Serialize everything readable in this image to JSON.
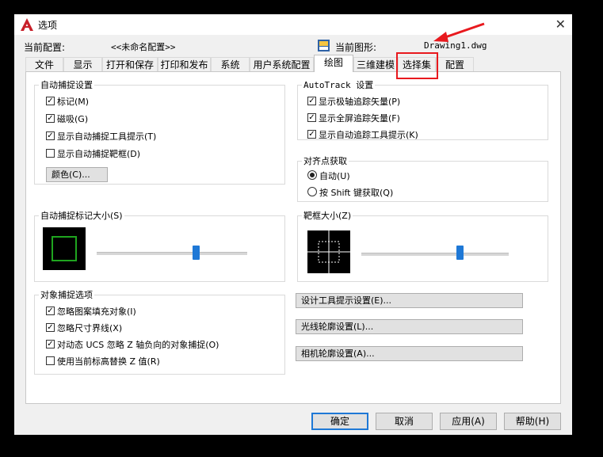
{
  "window": {
    "title": "选项",
    "close_glyph": "✕"
  },
  "header": {
    "profile_label": "当前配置:",
    "profile_value": "<<未命名配置>>",
    "drawing_label": "当前图形:",
    "drawing_value": "Drawing1.dwg"
  },
  "tabs": [
    {
      "label": "文件"
    },
    {
      "label": "显示"
    },
    {
      "label": "打开和保存"
    },
    {
      "label": "打印和发布"
    },
    {
      "label": "系统"
    },
    {
      "label": "用户系统配置"
    },
    {
      "label": "绘图",
      "active": true
    },
    {
      "label": "三维建模"
    },
    {
      "label": "选择集"
    },
    {
      "label": "配置"
    }
  ],
  "autosnap": {
    "title": "自动捕捉设置",
    "options": [
      {
        "label": "标记(M)",
        "checked": true
      },
      {
        "label": "磁吸(G)",
        "checked": true
      },
      {
        "label": "显示自动捕捉工具提示(T)",
        "checked": true
      },
      {
        "label": "显示自动捕捉靶框(D)",
        "checked": false
      }
    ],
    "color_button": "颜色(C)..."
  },
  "autotrack": {
    "title": "AutoTrack 设置",
    "options": [
      {
        "label": "显示极轴追踪矢量(P)",
        "checked": true
      },
      {
        "label": "显示全屏追踪矢量(F)",
        "checked": true
      },
      {
        "label": "显示自动追踪工具提示(K)",
        "checked": true
      }
    ]
  },
  "alignment": {
    "title": "对齐点获取",
    "options": [
      {
        "label": "自动(U)",
        "selected": true
      },
      {
        "label": "按 Shift 键获取(Q)",
        "selected": false
      }
    ]
  },
  "marker_size": {
    "title": "自动捕捉标记大小(S)",
    "level": 0.55,
    "marker_color": "#1fa51f"
  },
  "aperture_size": {
    "title": "靶框大小(Z)",
    "level": 0.6
  },
  "osnap": {
    "title": "对象捕捉选项",
    "options": [
      {
        "label": "忽略图案填充对象(I)",
        "checked": true
      },
      {
        "label": "忽略尺寸界线(X)",
        "checked": true
      },
      {
        "label": "对动态 UCS 忽略 Z 轴负向的对象捕捉(O)",
        "checked": true
      },
      {
        "label": "使用当前标高替换 Z 值(R)",
        "checked": false
      }
    ]
  },
  "settings_buttons": [
    "设计工具提示设置(E)...",
    "光线轮廓设置(L)...",
    "相机轮廓设置(A)..."
  ],
  "dialog_buttons": {
    "ok": "确定",
    "cancel": "取消",
    "apply": "应用(A)",
    "help": "帮助(H)"
  },
  "colors": {
    "accent": "#1e78d6",
    "highlight_box": "#e8191e",
    "arrow": "#e8191e"
  }
}
